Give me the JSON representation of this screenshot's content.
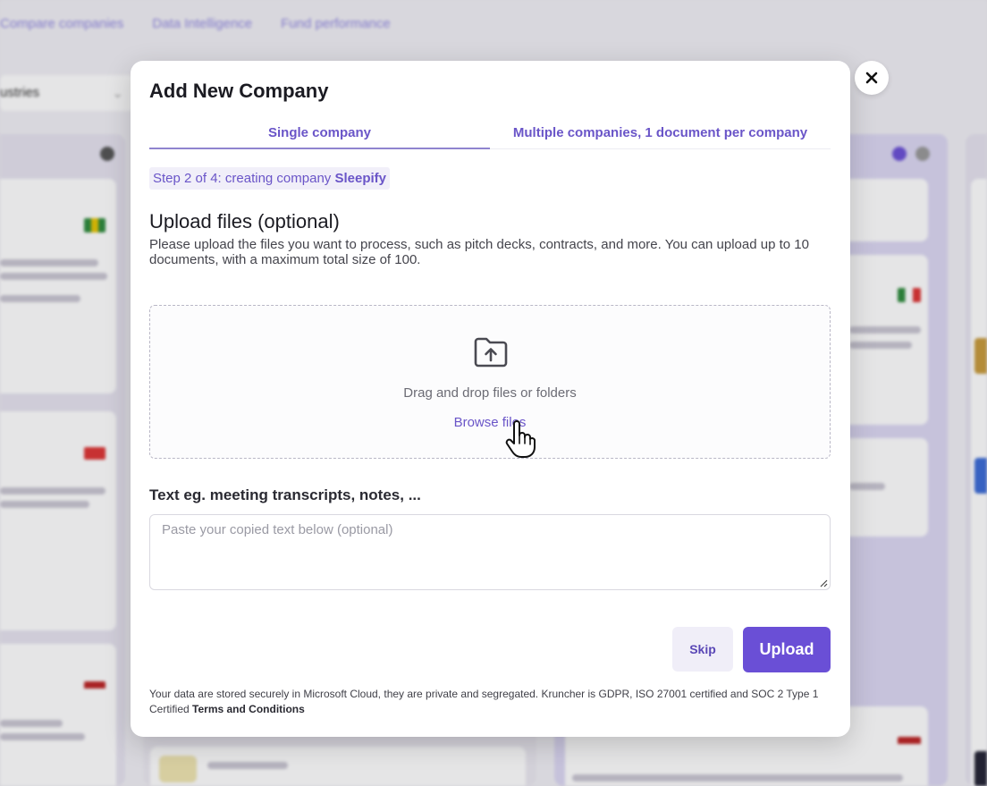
{
  "background": {
    "nav": [
      "Compare companies",
      "Data Intelligence",
      "Fund performance"
    ],
    "filter_label": "ustries"
  },
  "modal": {
    "title": "Add New Company",
    "tabs": [
      {
        "label": "Single company",
        "active": true
      },
      {
        "label": "Multiple companies, 1 document per company",
        "active": false
      }
    ],
    "step": {
      "prefix": "Step 2 of 4: creating company",
      "company": "Sleepify"
    },
    "upload": {
      "heading": "Upload files (optional)",
      "description": "Please upload the files you want to process, such as pitch decks, contracts, and more. You can upload up to 10 documents, with a maximum total size of 100.",
      "drop_text": "Drag and drop files or folders",
      "browse_label": "Browse files"
    },
    "text_input": {
      "label": "Text eg. meeting transcripts, notes, ...",
      "placeholder": "Paste your copied text below (optional)"
    },
    "buttons": {
      "skip": "Skip",
      "upload": "Upload"
    },
    "footer": {
      "text": "Your data are stored securely in Microsoft Cloud, they are private and segregated. Kruncher is GDPR, ISO 27001 certified and SOC 2 Type 1 Certified",
      "link": "Terms and Conditions"
    }
  },
  "colors": {
    "accent": "#6a4fd6",
    "accent_text": "#6a55c8"
  },
  "icons": [
    "close-icon",
    "folder-upload-icon",
    "hand-pointer-icon",
    "resize-grip-icon"
  ]
}
